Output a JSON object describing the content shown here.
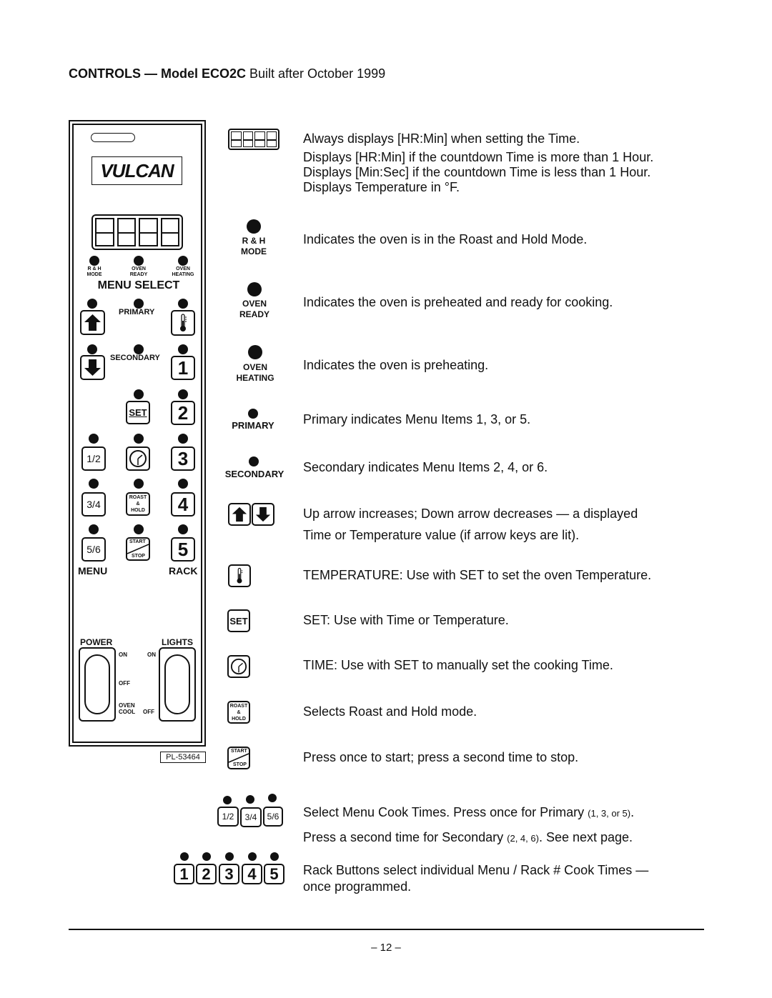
{
  "header": {
    "title_bold": "CONTROLS — Model ECO2C",
    "title_normal": " Built after October 1999"
  },
  "panel": {
    "logo": "VULCAN",
    "indicators": [
      {
        "line1": "R & H",
        "line2": "MODE"
      },
      {
        "line1": "OVEN",
        "line2": "READY"
      },
      {
        "line1": "OVEN",
        "line2": "HEATING"
      }
    ],
    "menu_select_label": "MENU SELECT",
    "primary_label": "PRIMARY",
    "secondary_label": "SECONDARY",
    "set_label": "SET",
    "menu_keys": [
      "1/2",
      "3/4",
      "5/6"
    ],
    "rack_keys": [
      "1",
      "2",
      "3",
      "4",
      "5"
    ],
    "roast_hold": {
      "line1": "ROAST",
      "line2": "&",
      "line3": "HOLD"
    },
    "start_stop": {
      "top": "START",
      "bottom": "STOP"
    },
    "menu_label": "MENU",
    "rack_label": "RACK",
    "power": {
      "label": "POWER",
      "on": "ON",
      "off": "OFF",
      "cool1": "OVEN",
      "cool2": "COOL"
    },
    "lights": {
      "label": "LIGHTS",
      "on": "ON",
      "off": "OFF"
    },
    "part_number": "PL-53464"
  },
  "legend": {
    "display": {
      "lines": [
        "Always displays [HR:Min] when setting the Time.",
        "Displays [HR:Min] if the countdown Time is more than 1 Hour.",
        "Displays [Min:Sec] if the countdown Time is less than 1 Hour.",
        "Displays Temperature in °F."
      ]
    },
    "rh_mode": {
      "icon_line1": "R & H",
      "icon_line2": "MODE",
      "text": "Indicates the oven is in the Roast and Hold Mode."
    },
    "oven_ready": {
      "icon_line1": "OVEN",
      "icon_line2": "READY",
      "text": "Indicates the oven is preheated and ready for cooking."
    },
    "oven_heating": {
      "icon_line1": "OVEN",
      "icon_line2": "HEATING",
      "text": "Indicates the oven is preheating."
    },
    "primary": {
      "icon_label": "PRIMARY",
      "text": "Primary indicates Menu Items 1, 3, or 5."
    },
    "secondary": {
      "icon_label": "SECONDARY",
      "text": "Secondary indicates Menu Items 2, 4, or 6."
    },
    "arrows": {
      "line1": "Up arrow increases; Down arrow decreases — a displayed",
      "line2": "Time or Temperature value (if arrow keys are lit)."
    },
    "temperature": {
      "text": "TEMPERATURE: Use with SET to set the oven Temperature."
    },
    "set": {
      "icon_label": "SET",
      "text": "SET: Use with Time or Temperature."
    },
    "time": {
      "text": "TIME: Use with SET to manually set the cooking Time."
    },
    "roast_hold": {
      "text": "Selects Roast and Hold mode."
    },
    "start_stop": {
      "text": "Press once to start; press a second time to stop."
    },
    "menu": {
      "line1_main": "Select Menu Cook Times.  Press once for Primary ",
      "line1_small": "(1, 3, or 5)",
      "line1_end": ".",
      "line2_main": "Press a second time for Secondary ",
      "line2_small": "(2, 4, 6)",
      "line2_end": ". See next page."
    },
    "rack": {
      "line1": "Rack Buttons select individual Menu / Rack # Cook Times —",
      "line2": "once programmed."
    }
  },
  "footer": {
    "page_number": "– 12 –"
  }
}
